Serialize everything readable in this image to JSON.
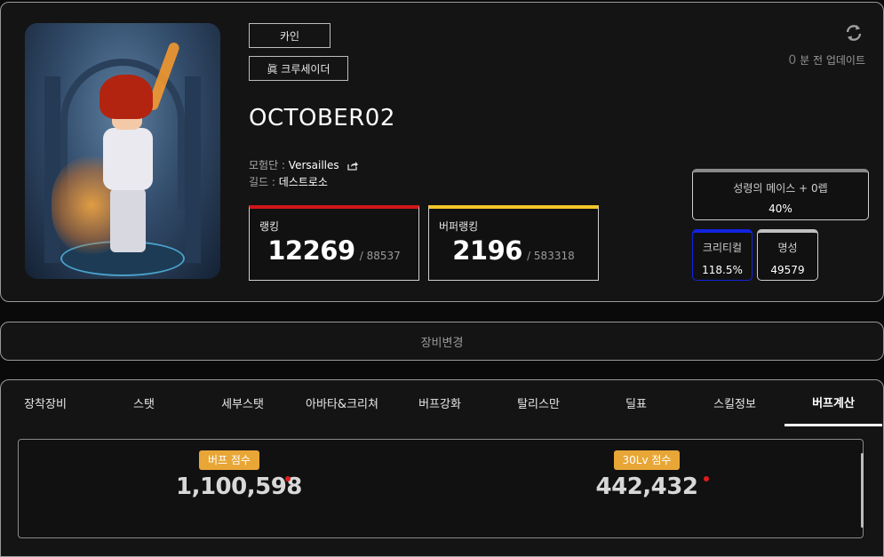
{
  "profile": {
    "server": "카인",
    "job_class": "眞 크루세이더",
    "character_name": "OCTOBER02",
    "adventure_label": "모험단 : ",
    "adventure_name": "Versailles",
    "guild_label": "길드 : ",
    "guild_name": "데스트로소",
    "update_minutes": "0",
    "update_suffix": "분 전 업데이트"
  },
  "ranking": {
    "label": "랭킹",
    "value": "12269",
    "total": "/ 88537",
    "color": "#d0161b"
  },
  "buffer_ranking": {
    "label": "버퍼랭킹",
    "value": "2196",
    "total": "/ 583318",
    "color": "#f2c52a"
  },
  "stats": {
    "mace": {
      "label": "성령의 메이스 + 0렙",
      "value": "40%"
    },
    "critical": {
      "label": "크리티컬",
      "value": "118.5%",
      "color": "#1224e0"
    },
    "fame": {
      "label": "명성",
      "value": "49579"
    }
  },
  "equip_change_label": "장비변경",
  "tabs": [
    {
      "label": "장착장비"
    },
    {
      "label": "스탯"
    },
    {
      "label": "세부스탯"
    },
    {
      "label": "아바타&크리쳐"
    },
    {
      "label": "버프강화"
    },
    {
      "label": "탈리스만"
    },
    {
      "label": "딜표"
    },
    {
      "label": "스킬정보"
    },
    {
      "label": "버프계산"
    }
  ],
  "active_tab": "버프계산",
  "scores": {
    "buff": {
      "label": "버프 점수",
      "value": "1,100,598"
    },
    "lv30": {
      "label": "30Lv 점수",
      "value": "442,432"
    }
  },
  "icons": {
    "refresh": "refresh-icon",
    "share": "share-icon"
  },
  "colors": {
    "badge": "#e8a636",
    "background": "#141414"
  }
}
